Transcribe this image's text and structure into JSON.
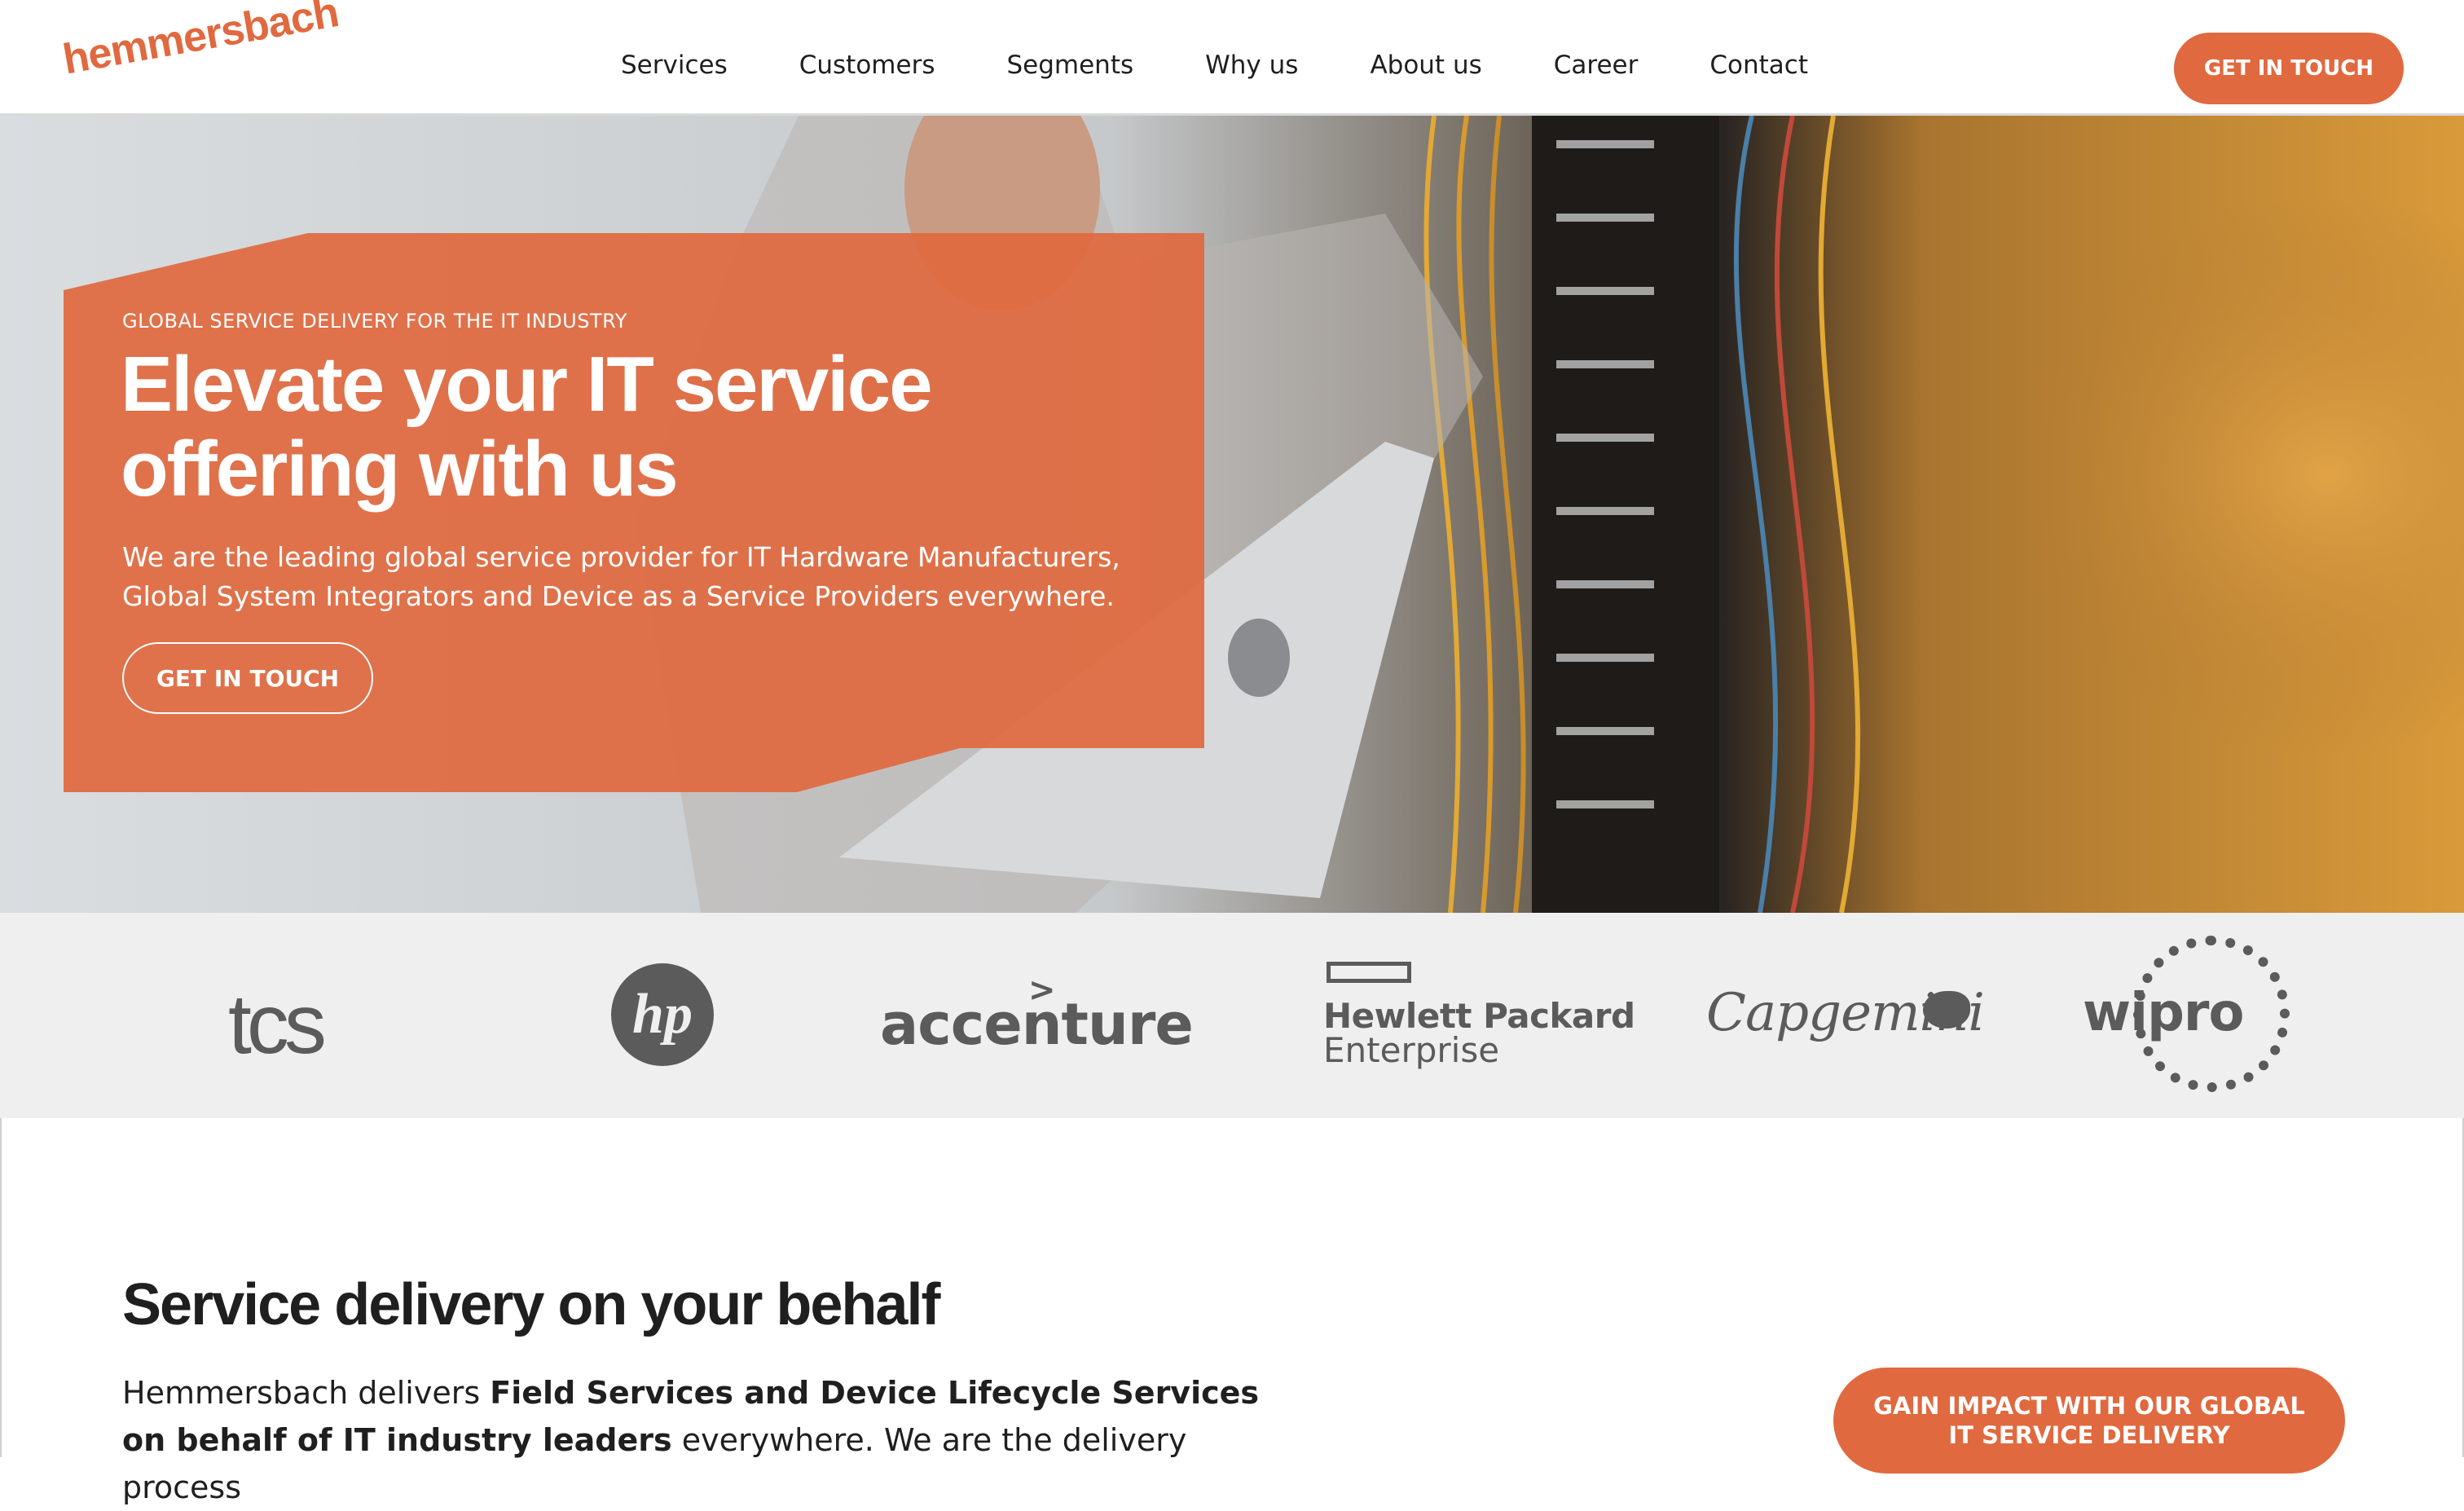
{
  "brand": {
    "logo_text": "hemmersbach",
    "accent_color": "#e0693f"
  },
  "nav": {
    "items": [
      "Services",
      "Customers",
      "Segments",
      "Why us",
      "About us",
      "Career",
      "Contact"
    ],
    "cta_label": "GET IN TOUCH"
  },
  "hero": {
    "kicker": "GLOBAL SERVICE DELIVERY FOR THE IT INDUSTRY",
    "headline_line1": "Elevate your IT service",
    "headline_line2": "offering with us",
    "lede": "We are the leading global service provider for IT Hardware Manufacturers, Global System Integrators and Device as a Service Providers everywhere.",
    "cta_label": "GET IN TOUCH"
  },
  "clients": {
    "tcs": "tcs",
    "hp": "hp",
    "accenture": "accenture",
    "accenture_mark": ">",
    "hpe_line1": "Hewlett Packard",
    "hpe_line2": "Enterprise",
    "capgemini": "Capgemini",
    "wipro": "wipro"
  },
  "section": {
    "title": "Service delivery on your behalf",
    "body_part1": "Hemmersbach delivers ",
    "body_bold": "Field Services and Device Lifecycle Services on behalf of IT industry leaders",
    "body_part2": " everywhere. We are the delivery process",
    "cta_label": "GAIN IMPACT WITH OUR GLOBAL IT SERVICE DELIVERY"
  }
}
